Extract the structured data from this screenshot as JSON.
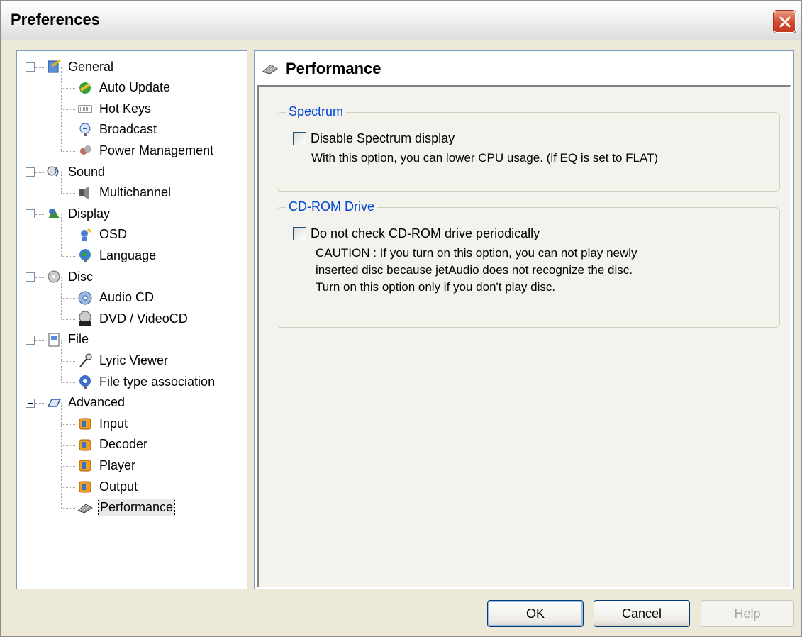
{
  "window": {
    "title": "Preferences"
  },
  "tree": {
    "items": [
      {
        "label": "General",
        "level": 0,
        "icon": "general-icon"
      },
      {
        "label": "Auto Update",
        "level": 1,
        "icon": "update-icon"
      },
      {
        "label": "Hot Keys",
        "level": 1,
        "icon": "keyboard-icon"
      },
      {
        "label": "Broadcast",
        "level": 1,
        "icon": "broadcast-icon"
      },
      {
        "label": "Power Management",
        "level": 1,
        "icon": "power-icon"
      },
      {
        "label": "Sound",
        "level": 0,
        "icon": "sound-icon"
      },
      {
        "label": "Multichannel",
        "level": 1,
        "icon": "speaker-icon"
      },
      {
        "label": "Display",
        "level": 0,
        "icon": "display-icon"
      },
      {
        "label": "OSD",
        "level": 1,
        "icon": "osd-icon"
      },
      {
        "label": "Language",
        "level": 1,
        "icon": "globe-icon"
      },
      {
        "label": "Disc",
        "level": 0,
        "icon": "disc-icon"
      },
      {
        "label": "Audio CD",
        "level": 1,
        "icon": "cd-icon"
      },
      {
        "label": "DVD / VideoCD",
        "level": 1,
        "icon": "dvd-icon"
      },
      {
        "label": "File",
        "level": 0,
        "icon": "file-icon"
      },
      {
        "label": "Lyric Viewer",
        "level": 1,
        "icon": "mic-icon"
      },
      {
        "label": "File type association",
        "level": 1,
        "icon": "association-icon"
      },
      {
        "label": "Advanced",
        "level": 0,
        "icon": "advanced-icon"
      },
      {
        "label": "Input",
        "level": 1,
        "icon": "plugin-icon"
      },
      {
        "label": "Decoder",
        "level": 1,
        "icon": "plugin-icon"
      },
      {
        "label": "Player",
        "level": 1,
        "icon": "plugin-icon"
      },
      {
        "label": "Output",
        "level": 1,
        "icon": "plugin-icon"
      },
      {
        "label": "Performance",
        "level": 1,
        "icon": "chip-icon",
        "selected": true
      }
    ]
  },
  "panel": {
    "title": "Performance",
    "spectrum": {
      "group_title": "Spectrum",
      "checkbox_label": "Disable Spectrum display",
      "checked": false,
      "note": "With this option, you can lower CPU usage. (if EQ is set to FLAT)"
    },
    "cdrom": {
      "group_title": "CD-ROM Drive",
      "checkbox_label": "Do not check CD-ROM drive periodically",
      "checked": false,
      "note_lines": [
        "CAUTION : If you turn on this option, you can not play newly",
        "inserted disc because jetAudio does not recognize the disc.",
        "Turn on this option only if you don't play disc."
      ]
    }
  },
  "buttons": {
    "ok": "OK",
    "cancel": "Cancel",
    "help": "Help"
  }
}
